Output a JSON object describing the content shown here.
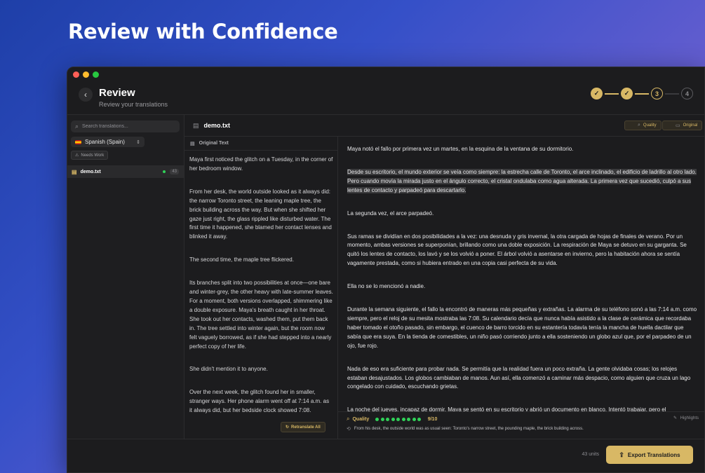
{
  "hero": {
    "title": "Review with Confidence"
  },
  "header": {
    "back_icon": "‹",
    "title": "Review",
    "subtitle": "Review your translations",
    "steps": [
      {
        "label": "✓",
        "state": "done"
      },
      {
        "label": "✓",
        "state": "done"
      },
      {
        "label": "3",
        "state": "current"
      },
      {
        "label": "4",
        "state": "todo"
      }
    ]
  },
  "sidebar": {
    "search_placeholder": "Search translations...",
    "language": "Spanish (Spain)",
    "filter_label": "Needs Work",
    "files": [
      {
        "name": "demo.txt",
        "count": "43",
        "status_color": "#30d158"
      }
    ]
  },
  "file_header": {
    "name": "demo.txt",
    "quality_label": "Quality",
    "original_label": "Original"
  },
  "original": {
    "label": "Original Text",
    "paragraphs": [
      "Maya first noticed the glitch on a Tuesday, in the corner of her bedroom window.",
      "From her desk, the world outside looked as it always did: the narrow Toronto street, the leaning maple tree, the brick building across the way. But when she shifted her gaze just right, the glass rippled like disturbed water. The first time it happened, she blamed her contact lenses and blinked it away.",
      "The second time, the maple tree flickered.",
      "Its branches split into two possibilities at once—one bare and winter-grey, the other heavy with late-summer leaves. For a moment, both versions overlapped, shimmering like a double exposure. Maya's breath caught in her throat. She took out her contacts, washed them, put them back in. The tree settled into winter again, but the room now felt vaguely borrowed, as if she had stepped into a nearly perfect copy of her life.",
      "She didn't mention it to anyone.",
      "Over the next week, the glitch found her in smaller, stranger ways. Her phone alarm went off at 7:14 a.m. as it always did, but her bedside clock showed 7:08."
    ],
    "retranslate_label": "Retranslate All"
  },
  "translation": {
    "paragraphs": [
      "Maya notó el fallo por primera vez un martes, en la esquina de la ventana de su dormitorio.",
      "Desde su escritorio, el mundo exterior se veía como siempre: la estrecha calle de Toronto, el arce inclinado, el edificio de ladrillo al otro lado. Pero cuando movía la mirada justo en el ángulo correcto, el cristal ondulaba como agua alterada. La primera vez que sucedió, culpó a sus lentes de contacto y parpadeó para descartarlo.",
      "La segunda vez, el arce parpadeó.",
      "Sus ramas se dividían en dos posibilidades a la vez: una desnuda y gris invernal, la otra cargada de hojas de finales de verano. Por un momento, ambas versiones se superponían, brillando como una doble exposición. La respiración de Maya se detuvo en su garganta. Se quitó los lentes de contacto, los lavó y se los volvió a poner. El árbol volvió a asentarse en invierno, pero la habitación ahora se sentía vagamente prestada, como si hubiera entrado en una copia casi perfecta de su vida.",
      "Ella no se lo mencionó a nadie.",
      "Durante la semana siguiente, el fallo la encontró de maneras más pequeñas y extrañas. La alarma de su teléfono sonó a las 7:14 a.m. como siempre, pero el reloj de su mesita mostraba las 7:08. Su calendario decía que nunca había asistido a la clase de cerámica que recordaba haber tomado el otoño pasado, sin embargo, el cuenco de barro torcido en su estantería todavía tenía la mancha de huella dactilar que sabía que era suya. En la tienda de comestibles, un niño pasó corriendo junto a ella sosteniendo un globo azul que, por el parpadeo de un ojo, fue rojo.",
      "Nada de eso era suficiente para probar nada. Se permitía que la realidad fuera un poco extraña. La gente olvidaba cosas; los relojes estaban desajustados. Los globos cambiaban de manos. Aun así, ella comenzó a caminar más despacio, como alguien que cruza un lago congelado con cuidado, escuchando grietas.",
      "La noche del jueves, incapaz de dormir, Maya se sentó en su escritorio y abrió un documento en blanco. Intentó trabajar, pero el"
    ],
    "highlighted_index": 1
  },
  "quality": {
    "label": "Quality",
    "score": "9/10",
    "score_value": 9,
    "score_max": 10,
    "highlights_label": "Highlights",
    "note": "From his desk, the outside world was as usual seen: Toronto's narrow street, the pounding maple, the brick building across."
  },
  "footer": {
    "units": "43 units",
    "export_label": "Export Translations"
  },
  "colors": {
    "accent": "#d8b865",
    "good": "#30d158",
    "bg": "#1c1c1e"
  }
}
